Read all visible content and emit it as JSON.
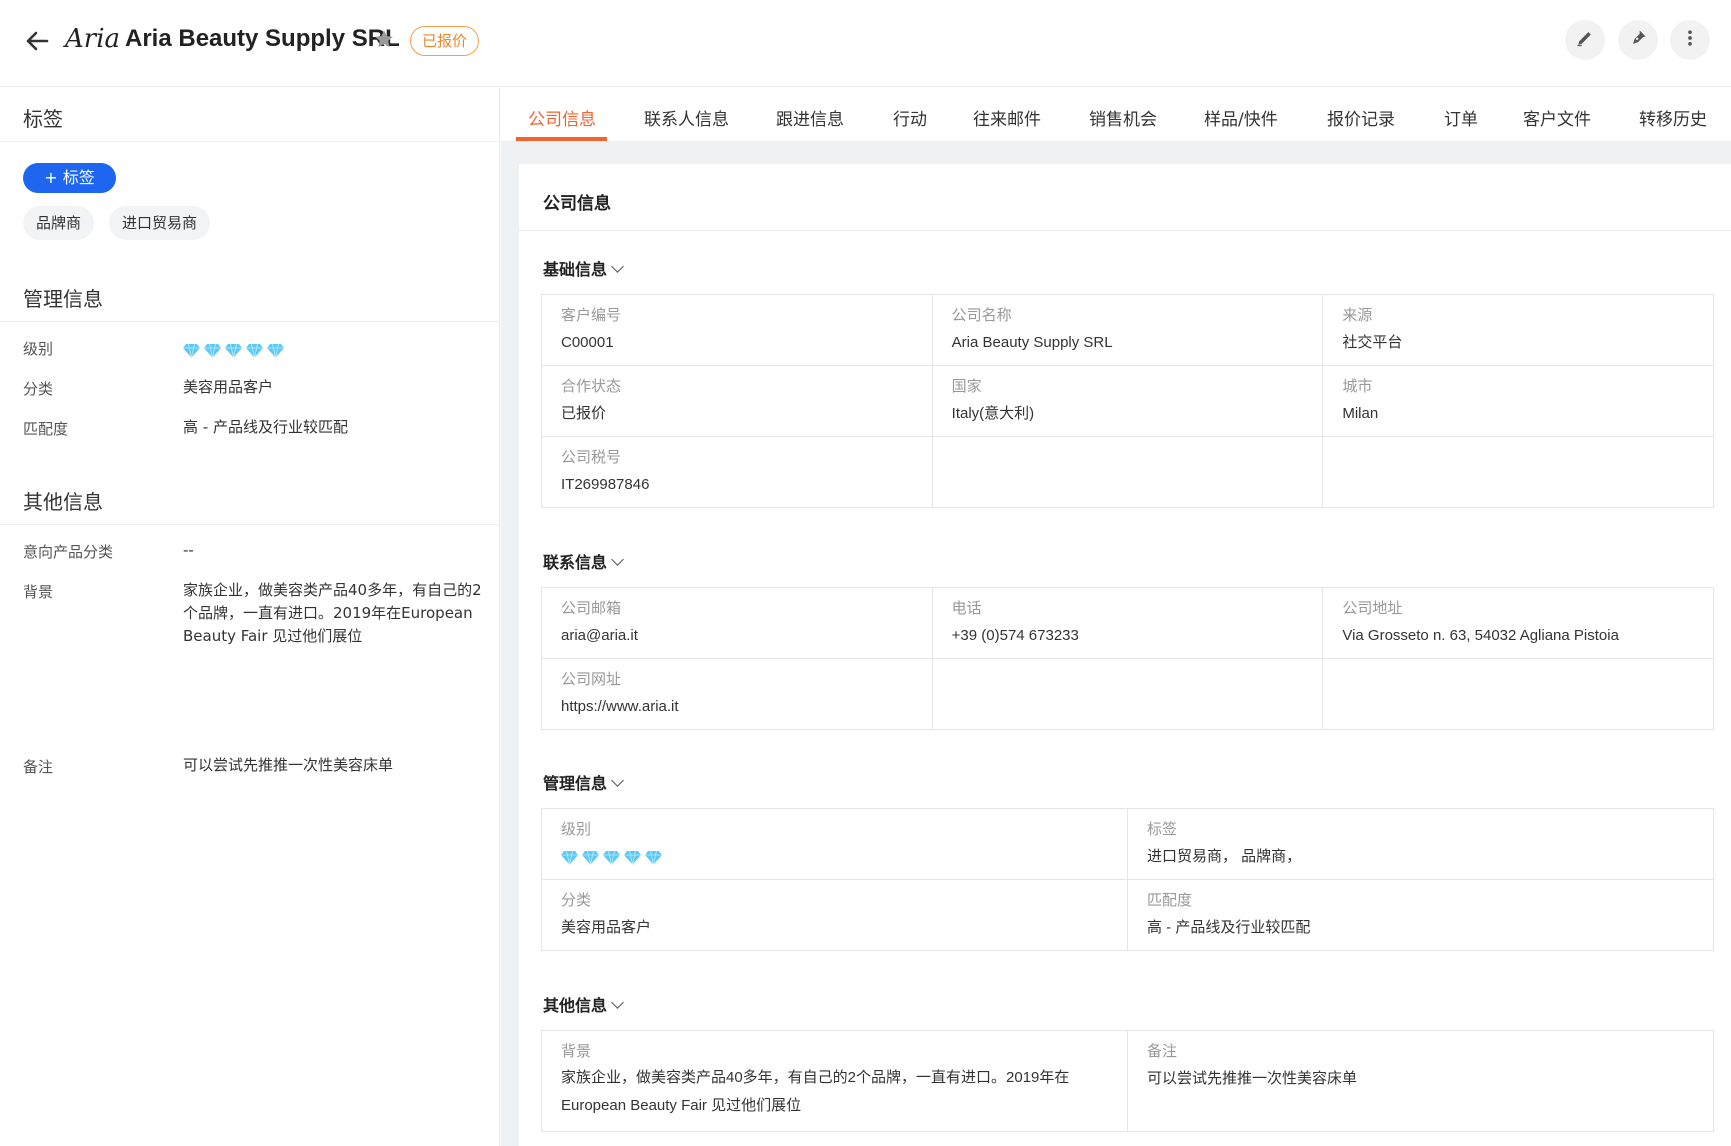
{
  "header": {
    "title": "Aria Beauty Supply SRL",
    "logo_text": "Aria",
    "status_badge": "已报价"
  },
  "sidebar": {
    "tags_title": "标签",
    "add_tag_label": "+ 标签",
    "tags": [
      "品牌商",
      "进口贸易商"
    ],
    "management": {
      "title": "管理信息",
      "rows": [
        {
          "label": "级别",
          "value": ""
        },
        {
          "label": "分类",
          "value": "美容用品客户"
        },
        {
          "label": "匹配度",
          "value": "高 - 产品线及行业较匹配"
        }
      ],
      "rating": 5
    },
    "other": {
      "title": "其他信息",
      "rows": [
        {
          "label": "意向产品分类",
          "value": "--"
        },
        {
          "label": "背景",
          "value": "家族企业，做美容类产品40多年，有自己的2个品牌，一直有进口。2019年在European Beauty Fair 见过他们展位"
        },
        {
          "label": "备注",
          "value": "可以尝试先推推一次性美容床单"
        }
      ]
    }
  },
  "tabs": [
    "公司信息",
    "联系人信息",
    "跟进信息",
    "行动",
    "往来邮件",
    "销售机会",
    "样品/快件",
    "报价记录",
    "订单",
    "客户文件",
    "转移历史"
  ],
  "main": {
    "panel_title": "公司信息",
    "basic": {
      "title": "基础信息",
      "rows": [
        [
          {
            "label": "客户编号",
            "value": "C00001"
          },
          {
            "label": "公司名称",
            "value": "Aria Beauty Supply SRL"
          },
          {
            "label": "来源",
            "value": "社交平台"
          }
        ],
        [
          {
            "label": "合作状态",
            "value": "已报价"
          },
          {
            "label": "国家",
            "value": "Italy(意大利)"
          },
          {
            "label": "城市",
            "value": "Milan"
          }
        ],
        [
          {
            "label": "公司税号",
            "value": "IT269987846"
          },
          {
            "label": "",
            "value": ""
          },
          {
            "label": "",
            "value": ""
          }
        ]
      ]
    },
    "contact": {
      "title": "联系信息",
      "rows": [
        [
          {
            "label": "公司邮箱",
            "value": "aria@aria.it"
          },
          {
            "label": "电话",
            "value": "+39 (0)574 673233"
          },
          {
            "label": "公司地址",
            "value": "Via Grosseto n. 63, 54032 Agliana Pistoia"
          }
        ],
        [
          {
            "label": "公司网址",
            "value": "https://www.aria.it"
          },
          {
            "label": "",
            "value": ""
          },
          {
            "label": "",
            "value": ""
          }
        ]
      ]
    },
    "management": {
      "title": "管理信息",
      "rating": 5,
      "level_label": "级别",
      "tags_label": "标签",
      "tags_value": "进口贸易商， 品牌商，",
      "category_label": "分类",
      "category_value": "美容用品客户",
      "match_label": "匹配度",
      "match_value": "高 - 产品线及行业较匹配"
    },
    "other": {
      "title": "其他信息",
      "background_label": "背景",
      "background_value": "家族企业，做美容类产品40多年，有自己的2个品牌，一直有进口。2019年在 European Beauty Fair 见过他们展位",
      "remark_label": "备注",
      "remark_value": "可以尝试先推推一次性美容床单"
    }
  },
  "colors": {
    "accent": "#f0652f",
    "primary": "#1e66f0",
    "gem": "#5bc8f5"
  }
}
